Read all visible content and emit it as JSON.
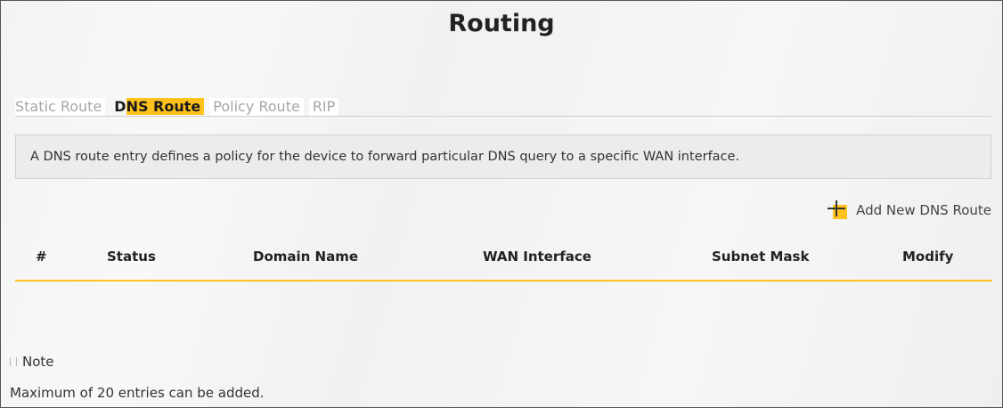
{
  "page": {
    "title": "Routing"
  },
  "tabs": [
    {
      "label_prefix": "",
      "label": "Static Route",
      "active": false
    },
    {
      "label_prefix": "D",
      "label": "NS Route",
      "active": true
    },
    {
      "label_prefix": "",
      "label": "Policy Route",
      "active": false
    },
    {
      "label_prefix": "",
      "label": "RIP",
      "active": false
    }
  ],
  "description": "A DNS route entry defines a policy for the device to forward particular DNS query to a specific WAN interface.",
  "add_button": {
    "label": "Add New DNS Route",
    "icon": "plus-icon"
  },
  "table": {
    "columns": [
      "#",
      "Status",
      "Domain Name",
      "WAN Interface",
      "Subnet Mask",
      "Modify"
    ],
    "rows": []
  },
  "note": {
    "heading": "Note",
    "text": "Maximum of 20 entries can be added."
  },
  "colors": {
    "accent": "#ffc21c",
    "tab_inactive": "#a6a6a6"
  }
}
